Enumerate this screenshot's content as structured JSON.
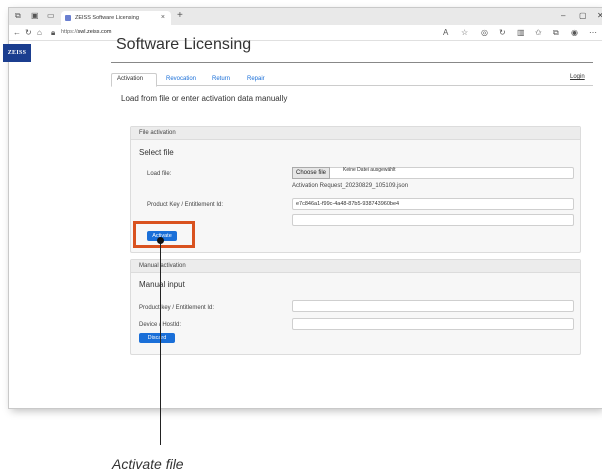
{
  "browser": {
    "tab_title": "ZEISS Software Licensing",
    "tab_close": "×",
    "new_tab": "+",
    "url_prefix": "https://",
    "url_host": "swl.zeiss.com"
  },
  "header": {
    "logo": "ZEISS",
    "title": "Software Licensing",
    "login": "Login"
  },
  "nav": {
    "tabs": [
      "Activation",
      "Revocation",
      "Return",
      "Repair"
    ],
    "active": "Activation"
  },
  "main": {
    "lead": "Load from file or enter activation data manually"
  },
  "file_activation": {
    "header": "File activation",
    "title": "Select file",
    "load_file_label": "Load file:",
    "choose_file_button": "Choose file",
    "no_file_text": "Keine Datei ausgewählt",
    "selected_file": "Activation Request_20230829_105109.json",
    "product_key_label": "Product Key / Entitlement Id:",
    "product_key_value": "e7c846a1-f99c-4a48-87b5-938743960be4",
    "extra_field_value": "",
    "activate_button": "Activate"
  },
  "manual_activation": {
    "header": "Manual activation",
    "title": "Manual input",
    "product_key_label": "Product key / Entitlement Id:",
    "product_key_value": "",
    "device_label": "Device / Hostld:",
    "device_value": "",
    "button": "Discard"
  },
  "annotation": {
    "caption": "Activate file",
    "highlight_color": "#d9521f"
  }
}
